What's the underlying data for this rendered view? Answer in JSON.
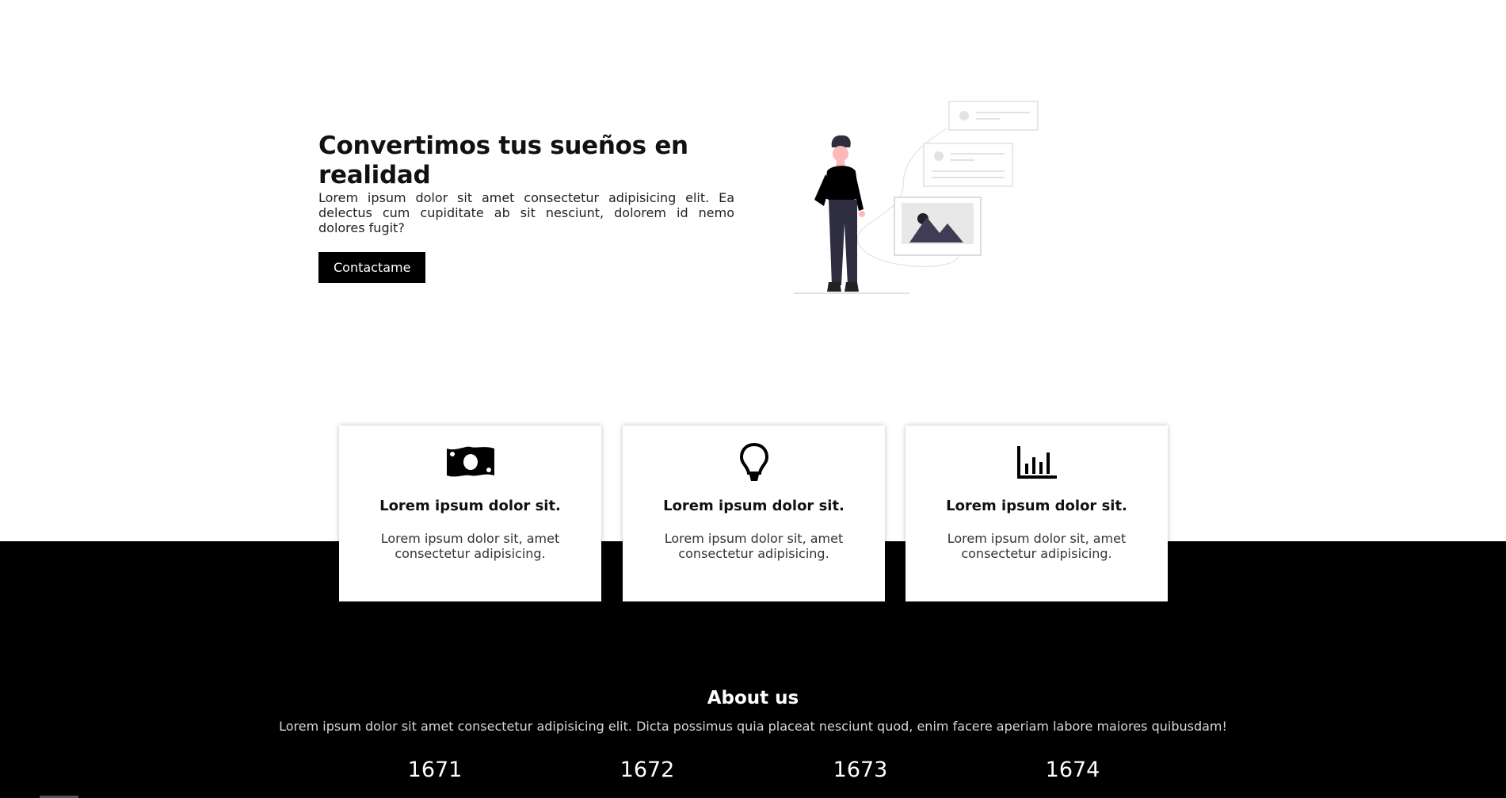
{
  "hero": {
    "title": "Convertimos tus sueños en realidad",
    "description": "Lorem ipsum dolor sit amet consectetur adipisicing elit. Ea delectus cum cupiditate ab sit nesciunt, dolorem id nemo dolores fugit?",
    "button_label": "Contactame"
  },
  "cards": [
    {
      "icon": "money-icon",
      "title": "Lorem ipsum dolor sit.",
      "text": "Lorem ipsum dolor sit, amet consectetur adipisicing."
    },
    {
      "icon": "lightbulb-icon",
      "title": "Lorem ipsum dolor sit.",
      "text": "Lorem ipsum dolor sit, amet consectetur adipisicing."
    },
    {
      "icon": "bar-chart-icon",
      "title": "Lorem ipsum dolor sit.",
      "text": "Lorem ipsum dolor sit, amet consectetur adipisicing."
    }
  ],
  "about": {
    "title": "About us",
    "text": "Lorem ipsum dolor sit amet consectetur adipisicing elit. Dicta possimus quia placeat nesciunt quod, enim facere aperiam labore maiores quibusdam!",
    "stats": [
      "1671",
      "1672",
      "1673",
      "1674"
    ]
  },
  "colors": {
    "primary": "#000000",
    "background": "#ffffff",
    "accent_text": "#ffffff"
  }
}
